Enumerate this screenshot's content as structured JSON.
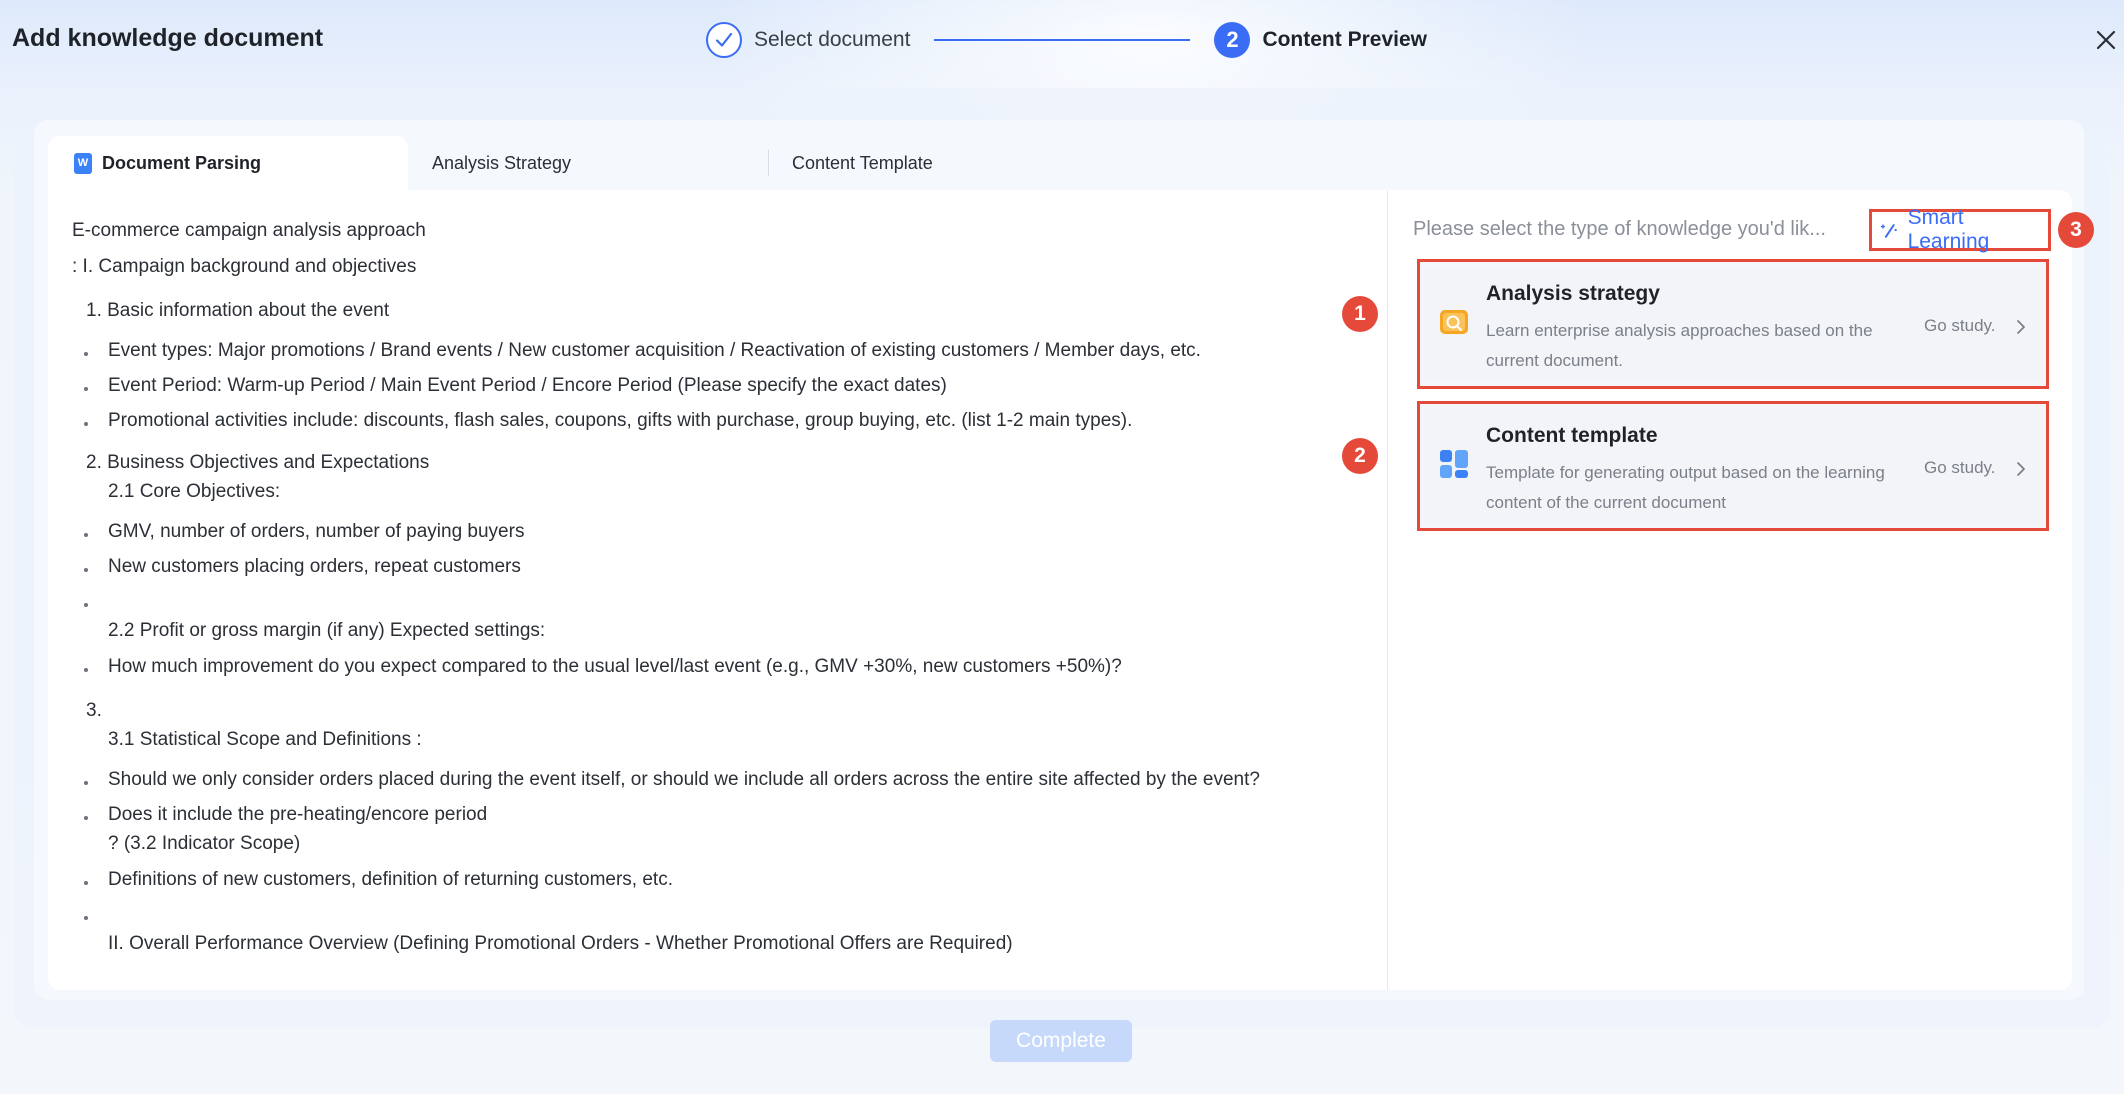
{
  "header": {
    "title": "Add knowledge document",
    "steps": [
      {
        "label": "Select document",
        "status": "done"
      },
      {
        "number": "2",
        "label": "Content Preview",
        "status": "active"
      }
    ]
  },
  "tabs": [
    {
      "label": "Document Parsing",
      "icon": "word-doc-icon",
      "active": true
    },
    {
      "label": "Analysis Strategy",
      "active": false
    },
    {
      "label": "Content Template",
      "active": false
    }
  ],
  "document": {
    "lines": [
      "E-commerce campaign analysis approach",
      ": I. Campaign background and objectives",
      "1. Basic information about the event",
      "Event types: Major promotions / Brand events / New customer acquisition / Reactivation of existing customers / Member days, etc.",
      "Event Period: Warm-up Period / Main Event Period / Encore Period (Please specify the exact dates)",
      "Promotional activities include: discounts, flash sales, coupons, gifts with purchase, group buying, etc. (list 1-2 main types).",
      "2. Business Objectives and Expectations",
      "2.1 Core Objectives:",
      "GMV, number of orders, number of paying buyers",
      "New customers placing orders, repeat customers",
      "",
      "2.2 Profit or gross margin (if any) Expected settings:",
      "How much improvement do you expect compared to the usual level/last event (e.g., GMV +30%, new customers +50%)?",
      "3.",
      "3.1 Statistical Scope and Definitions :",
      "Should we only consider orders placed during the event itself, or should we include all orders across the entire site affected by the event?",
      "Does it include the pre-heating/encore period",
      "? (3.2 Indicator Scope)",
      "Definitions of new customers, definition of returning customers, etc.",
      "",
      "II. Overall Performance Overview (Defining Promotional Orders - Whether Promotional Offers are Required)"
    ]
  },
  "side": {
    "prompt": "Please select the type of knowledge you'd lik...",
    "smart_learning": "Smart Learning",
    "options": [
      {
        "badge": "1",
        "title": "Analysis strategy",
        "desc": "Learn enterprise analysis approaches based on the current document.",
        "action": "Go study."
      },
      {
        "badge": "2",
        "title": "Content template",
        "desc": "Template for generating output based on the learning content of the current document",
        "action": "Go study."
      }
    ],
    "smart_badge": "3"
  },
  "footer": {
    "complete_label": "Complete"
  },
  "colors": {
    "accent": "#3b6cf6",
    "highlight": "#e5493a",
    "disabled_button": "#c6d9fb"
  }
}
